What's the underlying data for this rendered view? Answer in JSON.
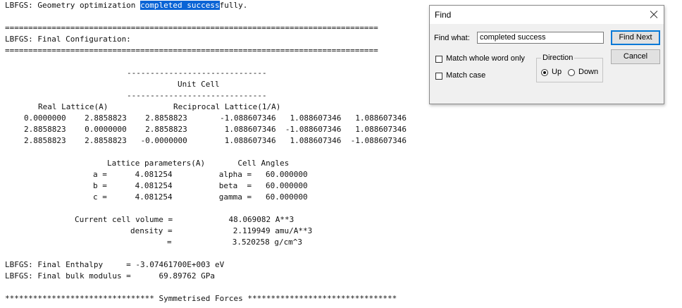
{
  "log": {
    "l1_pre": "LBFGS: Geometry optimization ",
    "l1_hl": "completed success",
    "l1_post": "fully.",
    "sep_eq": "================================================================================",
    "final_config": "LBFGS: Final Configuration:",
    "dash_short": "------------------------------",
    "unit_cell": "Unit Cell",
    "lattice_header": "Real Lattice(A)              Reciprocal Lattice(1/A)",
    "lattice_rows": [
      "0.0000000    2.8858823    2.8858823       -1.088607346   1.088607346   1.088607346",
      "2.8858823    0.0000000    2.8858823        1.088607346  -1.088607346   1.088607346",
      "2.8858823    2.8858823   -0.0000000        1.088607346   1.088607346  -1.088607346"
    ],
    "params_header": "Lattice parameters(A)       Cell Angles",
    "params_rows": [
      "a =      4.081254          alpha =   60.000000",
      "b =      4.081254          beta  =   60.000000",
      "c =      4.081254          gamma =   60.000000"
    ],
    "volume": "Current cell volume =            48.069082 A**3",
    "density1": "density =             2.119949 amu/A**3",
    "density2": "=             3.520258 g/cm^3",
    "enthalpy": "LBFGS: Final Enthalpy     = -3.07461700E+003 eV",
    "bulk": "LBFGS: Final bulk modulus =      69.89762 GPa",
    "forces": "******************************** Symmetrised Forces ********************************"
  },
  "dialog": {
    "title": "Find",
    "find_what_label": "Find what:",
    "find_what_value": "completed success",
    "find_next": "Find Next",
    "cancel": "Cancel",
    "match_whole_word": "Match whole word only",
    "match_case": "Match case",
    "direction": "Direction",
    "up": "Up",
    "down": "Down",
    "icons": {
      "close": "close-icon"
    },
    "colors": {
      "highlight": "#0a64d6",
      "default_button_border": "#0078d7"
    }
  }
}
